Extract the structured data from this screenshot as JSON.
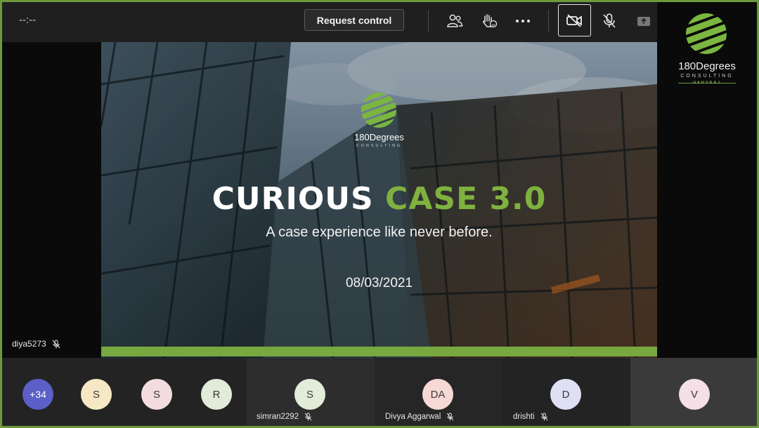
{
  "toolbar": {
    "timer": "--:--",
    "request_control_label": "Request control",
    "icons": [
      "participants-icon",
      "raise-hand-icon",
      "more-options-icon",
      "camera-off-icon",
      "mic-off-icon",
      "share-tray-icon"
    ]
  },
  "brand": {
    "logo_name": "180Degrees",
    "logo_sub": "CONSULTING",
    "logo_sub2": "HANSRAJ",
    "green": "#7fb13f"
  },
  "presenter": {
    "name": "diya5273"
  },
  "slide": {
    "logo_name": "180Degrees",
    "logo_sub": "CONSULTING",
    "title_white": "CURIOUS",
    "title_green": "CASE 3.0",
    "subtitle": "A case experience like never before.",
    "date": "08/03/2021"
  },
  "participants": {
    "overflow": "+34",
    "small": [
      {
        "initial": "S",
        "color": "#f6e8c4"
      },
      {
        "initial": "S",
        "color": "#f3dcdf"
      },
      {
        "initial": "R",
        "color": "#e2ead9"
      }
    ],
    "tiles": [
      {
        "initial": "S",
        "name": "simran2292",
        "color": "#e3ecd9"
      },
      {
        "initial": "DA",
        "name": "Divya Aggarwal",
        "color": "#f6d9d4"
      },
      {
        "initial": "D",
        "name": "drishti",
        "color": "#dfe0f4"
      },
      {
        "initial": "V",
        "name": "",
        "color": "#f4e0e6"
      }
    ]
  }
}
